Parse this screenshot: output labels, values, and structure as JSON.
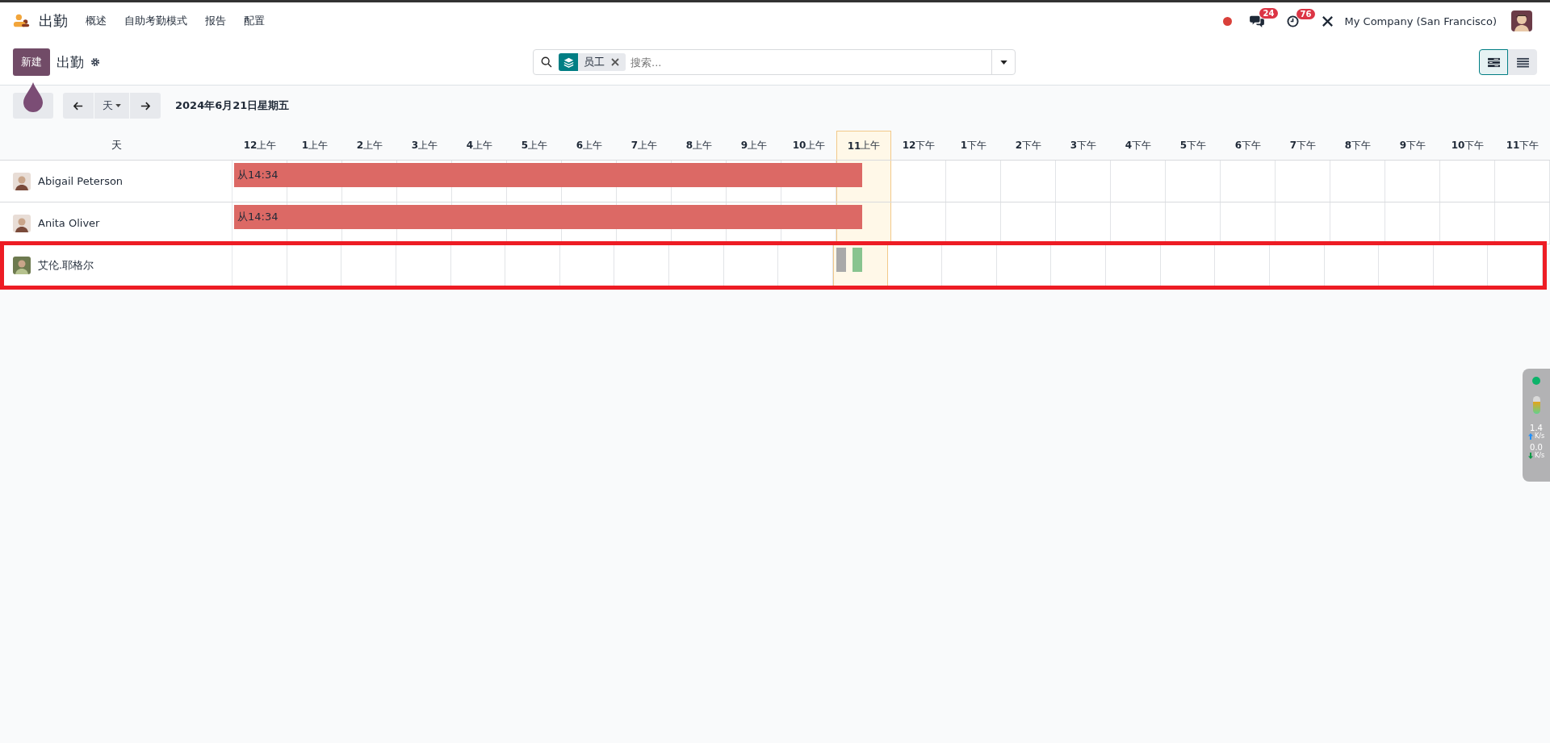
{
  "app": {
    "title": "出勤",
    "menu": [
      "概述",
      "自助考勤模式",
      "报告",
      "配置"
    ]
  },
  "systray": {
    "recording": true,
    "messages_count": "24",
    "activities_count": "76",
    "company": "My Company (San Francisco)"
  },
  "control_panel": {
    "new_button": "新建",
    "breadcrumb": "出勤",
    "search": {
      "facet_label": "员工",
      "placeholder": "搜索..."
    },
    "views": [
      {
        "kind": "gantt",
        "selected": true
      },
      {
        "kind": "list",
        "selected": false
      }
    ]
  },
  "toolbar": {
    "scale": "天",
    "date": "2024年6月21日星期五"
  },
  "gantt": {
    "corner": "天",
    "hours": [
      {
        "label": "12",
        "suffix": "上午",
        "current": false
      },
      {
        "label": "1",
        "suffix": "上午",
        "current": false
      },
      {
        "label": "2",
        "suffix": "上午",
        "current": false
      },
      {
        "label": "3",
        "suffix": "上午",
        "current": false
      },
      {
        "label": "4",
        "suffix": "上午",
        "current": false
      },
      {
        "label": "5",
        "suffix": "上午",
        "current": false
      },
      {
        "label": "6",
        "suffix": "上午",
        "current": false
      },
      {
        "label": "7",
        "suffix": "上午",
        "current": false
      },
      {
        "label": "8",
        "suffix": "上午",
        "current": false
      },
      {
        "label": "9",
        "suffix": "上午",
        "current": false
      },
      {
        "label": "10",
        "suffix": "上午",
        "current": false
      },
      {
        "label": "11",
        "suffix": "上午",
        "current": true
      },
      {
        "label": "12",
        "suffix": "下午",
        "current": false
      },
      {
        "label": "1",
        "suffix": "下午",
        "current": false
      },
      {
        "label": "2",
        "suffix": "下午",
        "current": false
      },
      {
        "label": "3",
        "suffix": "下午",
        "current": false
      },
      {
        "label": "4",
        "suffix": "下午",
        "current": false
      },
      {
        "label": "5",
        "suffix": "下午",
        "current": false
      },
      {
        "label": "6",
        "suffix": "下午",
        "current": false
      },
      {
        "label": "7",
        "suffix": "下午",
        "current": false
      },
      {
        "label": "8",
        "suffix": "下午",
        "current": false
      },
      {
        "label": "9",
        "suffix": "下午",
        "current": false
      },
      {
        "label": "10",
        "suffix": "下午",
        "current": false
      },
      {
        "label": "11",
        "suffix": "下午",
        "current": false
      }
    ],
    "rows": [
      {
        "name": "Abigail Peterson",
        "highlighted": false,
        "bars": [
          {
            "kind": "span",
            "label": "从14:34",
            "color": "#dc6965"
          }
        ]
      },
      {
        "name": "Anita Oliver",
        "highlighted": false,
        "bars": [
          {
            "kind": "span",
            "label": "从14:34",
            "color": "#dc6965"
          }
        ]
      },
      {
        "name": "艾伦.耶格尔",
        "highlighted": true,
        "bars": [
          {
            "kind": "mark",
            "color": "#a9a9a9"
          },
          {
            "kind": "mark",
            "color": "#88c48f"
          }
        ]
      }
    ]
  },
  "net_monitor": {
    "upload": "1.4",
    "upload_unit": "K/s",
    "download": "0.0",
    "download_unit": "K/s"
  }
}
